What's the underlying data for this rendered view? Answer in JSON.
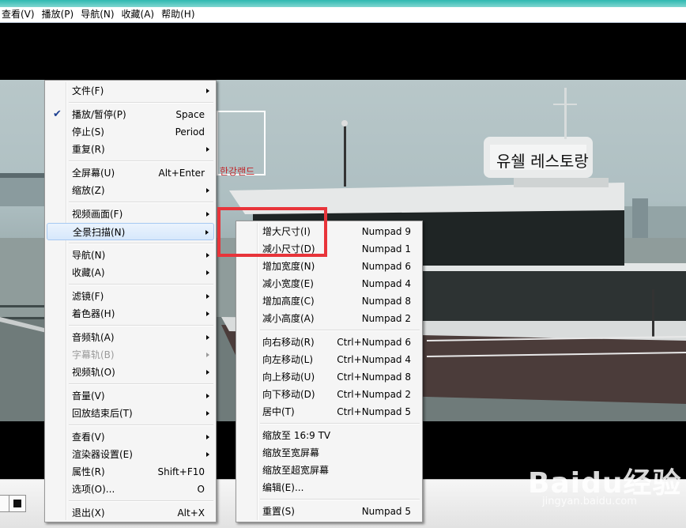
{
  "menubar": [
    {
      "label": "查看(V)",
      "name": "menubar-view"
    },
    {
      "label": "播放(P)",
      "name": "menubar-play"
    },
    {
      "label": "导航(N)",
      "name": "menubar-navigate"
    },
    {
      "label": "收藏(A)",
      "name": "menubar-favorites"
    },
    {
      "label": "帮助(H)",
      "name": "menubar-help"
    }
  ],
  "video": {
    "sign_text": "유쉘 레스토랑",
    "sign_left": "한강랜드"
  },
  "context_menu": [
    {
      "label": "文件(F)",
      "submenu": true
    },
    {
      "sep": true
    },
    {
      "label": "播放/暂停(P)",
      "shortcut": "Space",
      "checked": true
    },
    {
      "label": "停止(S)",
      "shortcut": "Period"
    },
    {
      "label": "重复(R)",
      "submenu": true
    },
    {
      "sep": true
    },
    {
      "label": "全屏幕(U)",
      "shortcut": "Alt+Enter"
    },
    {
      "label": "缩放(Z)",
      "submenu": true
    },
    {
      "sep": true
    },
    {
      "label": "视频画面(F)",
      "submenu": true
    },
    {
      "label": "全景扫描(N)",
      "submenu": true,
      "highlighted": true
    },
    {
      "sep": true
    },
    {
      "label": "导航(N)",
      "submenu": true
    },
    {
      "label": "收藏(A)",
      "submenu": true
    },
    {
      "sep": true
    },
    {
      "label": "滤镜(F)",
      "submenu": true
    },
    {
      "label": "着色器(H)",
      "submenu": true
    },
    {
      "sep": true
    },
    {
      "label": "音频轨(A)",
      "submenu": true
    },
    {
      "label": "字幕轨(B)",
      "submenu": true,
      "disabled": true
    },
    {
      "label": "视频轨(O)",
      "submenu": true
    },
    {
      "sep": true
    },
    {
      "label": "音量(V)",
      "submenu": true
    },
    {
      "label": "回放结束后(T)",
      "submenu": true
    },
    {
      "sep": true
    },
    {
      "label": "查看(V)",
      "submenu": true
    },
    {
      "label": "渲染器设置(E)",
      "submenu": true
    },
    {
      "label": "属性(R)",
      "shortcut": "Shift+F10"
    },
    {
      "label": "选项(O)...",
      "shortcut": "O"
    },
    {
      "sep": true
    },
    {
      "label": "退出(X)",
      "shortcut": "Alt+X"
    }
  ],
  "pan_scan_submenu": [
    {
      "label": "增大尺寸(I)",
      "shortcut": "Numpad 9"
    },
    {
      "label": "减小尺寸(D)",
      "shortcut": "Numpad 1"
    },
    {
      "label": "增加宽度(N)",
      "shortcut": "Numpad 6"
    },
    {
      "label": "减小宽度(E)",
      "shortcut": "Numpad 4"
    },
    {
      "label": "增加高度(C)",
      "shortcut": "Numpad 8"
    },
    {
      "label": "减小高度(A)",
      "shortcut": "Numpad 2"
    },
    {
      "sep": true
    },
    {
      "label": "向右移动(R)",
      "shortcut": "Ctrl+Numpad 6"
    },
    {
      "label": "向左移动(L)",
      "shortcut": "Ctrl+Numpad 4"
    },
    {
      "label": "向上移动(U)",
      "shortcut": "Ctrl+Numpad 8"
    },
    {
      "label": "向下移动(D)",
      "shortcut": "Ctrl+Numpad 2"
    },
    {
      "label": "居中(T)",
      "shortcut": "Ctrl+Numpad 5"
    },
    {
      "sep": true
    },
    {
      "label": "缩放至 16:9 TV"
    },
    {
      "label": "缩放至宽屏幕"
    },
    {
      "label": "缩放至超宽屏幕"
    },
    {
      "label": "编辑(E)..."
    },
    {
      "sep": true
    },
    {
      "label": "重置(S)",
      "shortcut": "Numpad 5"
    }
  ],
  "watermark": {
    "logo": "Baidu经验",
    "url": "jingyan.baidu.com"
  },
  "colors": {
    "highlight_box": "#e8343a",
    "menu_highlight": "#d7e8fb",
    "check_mark": "#1c3f91"
  }
}
